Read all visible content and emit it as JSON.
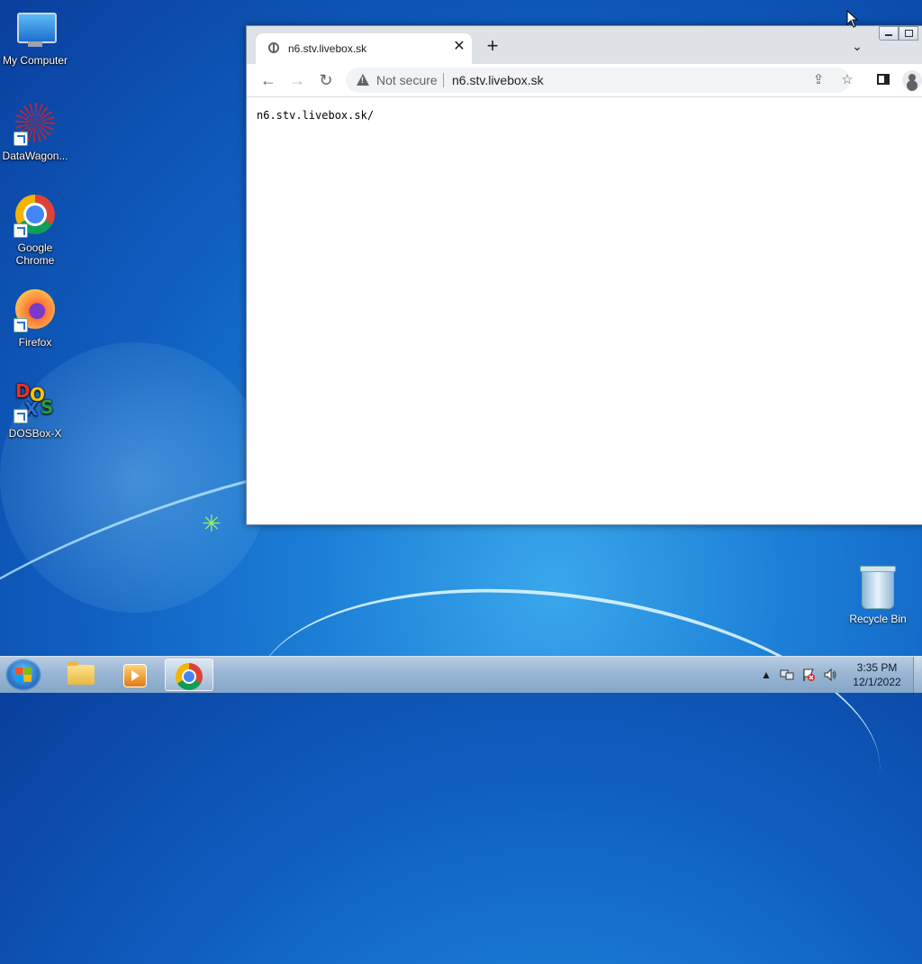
{
  "desktop": {
    "icons": [
      {
        "label": "My Computer"
      },
      {
        "label": "DataWagon..."
      },
      {
        "label": "Google Chrome"
      },
      {
        "label": "Firefox"
      },
      {
        "label": "DOSBox-X"
      },
      {
        "label": "Recycle Bin"
      }
    ]
  },
  "browser": {
    "tab": {
      "title": "n6.stv.livebox.sk",
      "close_glyph": "✕"
    },
    "new_tab_glyph": "+",
    "tab_search_glyph": "⌄",
    "toolbar": {
      "back_glyph": "←",
      "forward_glyph": "→",
      "reload_glyph": "↻",
      "security_label": "Not secure",
      "url": "n6.stv.livebox.sk",
      "share_glyph": "⇪",
      "bookmark_glyph": "☆"
    },
    "page": {
      "text": "n6.stv.livebox.sk/"
    }
  },
  "taskbar": {
    "items": [
      "windows-explorer",
      "media-player",
      "google-chrome"
    ],
    "tray": {
      "chevron_glyph": "▲"
    },
    "clock": {
      "time": "3:35 PM",
      "date": "12/1/2022"
    }
  }
}
